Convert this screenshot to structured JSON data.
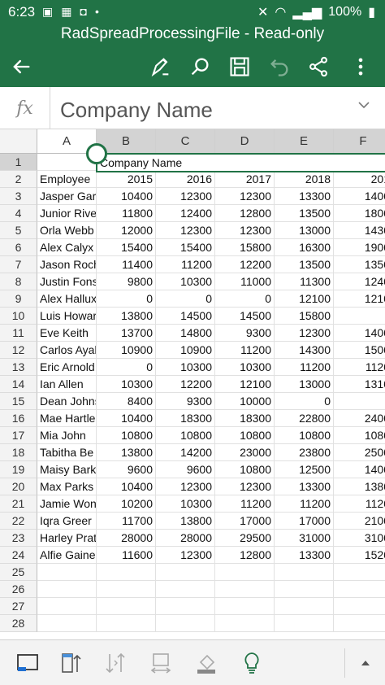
{
  "status": {
    "time": "6:23",
    "battery": "100%"
  },
  "app": {
    "title": "RadSpreadProcessingFile - Read-only"
  },
  "formula": {
    "fx_label": "fx",
    "value": "Company Name"
  },
  "columns": [
    "A",
    "B",
    "C",
    "D",
    "E",
    "F"
  ],
  "rows": [
    "1",
    "2",
    "3",
    "4",
    "5",
    "6",
    "7",
    "8",
    "9",
    "10",
    "11",
    "12",
    "13",
    "14",
    "15",
    "16",
    "17",
    "18",
    "19",
    "20",
    "21",
    "22",
    "23",
    "24",
    "25",
    "26",
    "27",
    "28"
  ],
  "merged_title": "Company Name",
  "header_row": [
    "Employee",
    "2015",
    "2016",
    "2017",
    "2018",
    "201"
  ],
  "data_rows": [
    [
      "Jasper Garc",
      "10400",
      "12300",
      "12300",
      "13300",
      "1400"
    ],
    [
      "Junior Rive",
      "11800",
      "12400",
      "12800",
      "13500",
      "1800"
    ],
    [
      "Orla Webb",
      "12000",
      "12300",
      "12300",
      "13000",
      "1430"
    ],
    [
      "Alex Calyx",
      "15400",
      "15400",
      "15800",
      "16300",
      "1900"
    ],
    [
      "Jason Roch",
      "11400",
      "11200",
      "12200",
      "13500",
      "1350"
    ],
    [
      "Justin Fons",
      "9800",
      "10300",
      "11000",
      "11300",
      "1240"
    ],
    [
      "Alex Hallux",
      "0",
      "0",
      "0",
      "12100",
      "1210"
    ],
    [
      "Luis Howar",
      "13800",
      "14500",
      "14500",
      "15800",
      ""
    ],
    [
      "Eve Keith",
      "13700",
      "14800",
      "9300",
      "12300",
      "1400"
    ],
    [
      "Carlos Ayal",
      "10900",
      "10900",
      "11200",
      "14300",
      "1500"
    ],
    [
      "Eric Arnold",
      "0",
      "10300",
      "10300",
      "11200",
      "1120"
    ],
    [
      "Ian Allen",
      "10300",
      "12200",
      "12100",
      "13000",
      "1310"
    ],
    [
      "Dean Johns",
      "8400",
      "9300",
      "10000",
      "0",
      ""
    ],
    [
      "Mae Hartle",
      "10400",
      "18300",
      "18300",
      "22800",
      "2400"
    ],
    [
      "Mia John",
      "10800",
      "10800",
      "10800",
      "10800",
      "1080"
    ],
    [
      "Tabitha Be",
      "13800",
      "14200",
      "23000",
      "23800",
      "2500"
    ],
    [
      "Maisy Bark",
      "9600",
      "9600",
      "10800",
      "12500",
      "1400"
    ],
    [
      "Max Parks",
      "10400",
      "12300",
      "12300",
      "13300",
      "1380"
    ],
    [
      "Jamie Won",
      "10200",
      "10300",
      "11200",
      "11200",
      "1120"
    ],
    [
      "Iqra Greer",
      "11700",
      "13800",
      "17000",
      "17000",
      "2100"
    ],
    [
      "Harley Prat",
      "28000",
      "28000",
      "29500",
      "31000",
      "3100"
    ],
    [
      "Alfie Gaine",
      "11600",
      "12300",
      "12800",
      "13300",
      "1520"
    ]
  ],
  "colors": {
    "accent": "#217346",
    "header_sel": "#d3d3d3"
  },
  "icons": {
    "toolbar": [
      "back-arrow-icon",
      "pen-icon",
      "search-icon",
      "save-icon",
      "undo-icon",
      "share-icon",
      "more-vert-icon"
    ],
    "bottom": [
      "sheet-view-icon",
      "freeze-panes-icon",
      "sort-icon",
      "fit-icon",
      "fill-icon",
      "lightbulb-icon",
      "expand-up-icon"
    ]
  }
}
